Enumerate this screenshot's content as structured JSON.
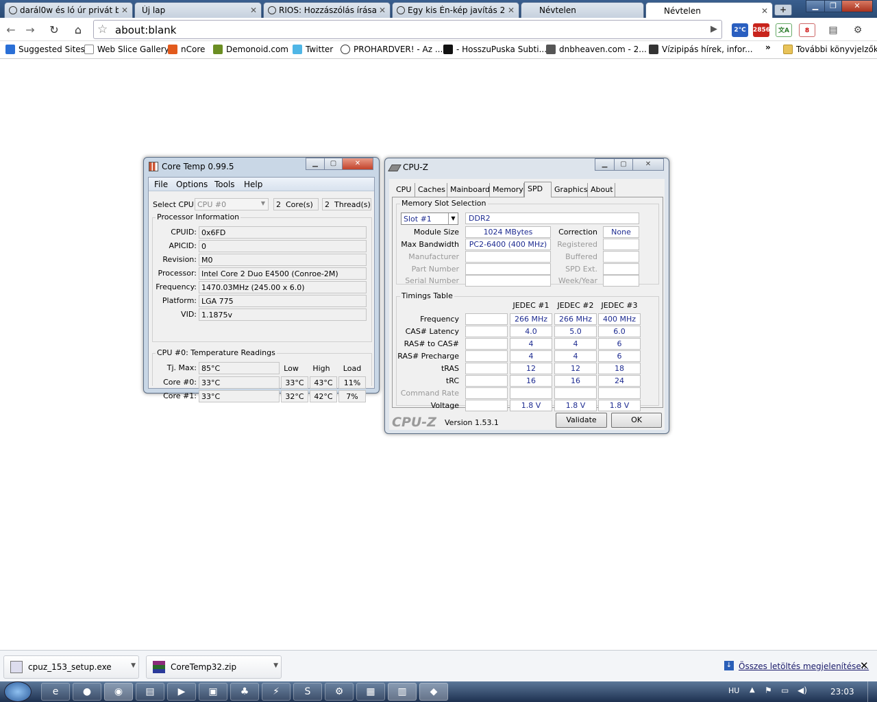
{
  "browser": {
    "tabs": [
      {
        "title": "darál0w és ló úr privát b..."
      },
      {
        "title": "Új lap"
      },
      {
        "title": "RIOS: Hozzászólás írása ..."
      },
      {
        "title": "Egy kis Én-kép javítás 2..."
      },
      {
        "title": "Névtelen"
      },
      {
        "title": "Névtelen"
      }
    ],
    "url": "about:blank",
    "extensions": {
      "temp": "2°C",
      "mail": "2856",
      "badge": "8"
    },
    "bookmarks": [
      "Suggested Sites",
      "Web Slice Gallery",
      "nCore",
      "Demonoid.com",
      "Twitter",
      "PROHARDVER! - Az ...",
      "- HosszuPuska Subti...",
      "dnbheaven.com - 2...",
      "Vízipipás hírek, infor..."
    ],
    "more_bookmarks": "További könyvjelzők",
    "chevron": "»"
  },
  "coretemp": {
    "title": "Core Temp 0.99.5",
    "menu": [
      "File",
      "Options",
      "Tools",
      "Help"
    ],
    "select_cpu_label": "Select CPU:",
    "select_cpu_value": "CPU #0",
    "cores_count": "2",
    "cores_label": "Core(s)",
    "threads_count": "2",
    "threads_label": "Thread(s)",
    "proc_info_title": "Processor Information",
    "info": [
      {
        "label": "CPUID:",
        "value": "0x6FD"
      },
      {
        "label": "APICID:",
        "value": "0"
      },
      {
        "label": "Revision:",
        "value": "M0"
      },
      {
        "label": "Processor:",
        "value": "Intel Core 2 Duo E4500 (Conroe-2M)"
      },
      {
        "label": "Frequency:",
        "value": "1470.03MHz (245.00 x 6.0)"
      },
      {
        "label": "Platform:",
        "value": "LGA 775"
      },
      {
        "label": "VID:",
        "value": "1.1875v"
      }
    ],
    "temp_title": "CPU #0: Temperature Readings",
    "col_low": "Low",
    "col_high": "High",
    "col_load": "Load",
    "tjmax_label": "Tj. Max:",
    "tjmax_value": "85°C",
    "cores": [
      {
        "label": "Core #0:",
        "temp": "33°C",
        "low": "33°C",
        "high": "43°C",
        "load": "11%"
      },
      {
        "label": "Core #1:",
        "temp": "33°C",
        "low": "32°C",
        "high": "42°C",
        "load": "7%"
      }
    ]
  },
  "cpuz": {
    "title": "CPU-Z",
    "tabs": [
      "CPU",
      "Caches",
      "Mainboard",
      "Memory",
      "SPD",
      "Graphics",
      "About"
    ],
    "slot_group_title": "Memory Slot Selection",
    "slot_value": "Slot #1",
    "mem_type": "DDR2",
    "module_size_label": "Module Size",
    "module_size": "1024 MBytes",
    "max_bw_label": "Max Bandwidth",
    "max_bw": "PC2-6400 (400 MHz)",
    "manufacturer_label": "Manufacturer",
    "part_label": "Part Number",
    "serial_label": "Serial Number",
    "correction_label": "Correction",
    "correction": "None",
    "registered_label": "Registered",
    "buffered_label": "Buffered",
    "spdext_label": "SPD Ext.",
    "weekyear_label": "Week/Year",
    "timings_title": "Timings Table",
    "jedec_headers": [
      "JEDEC #1",
      "JEDEC #2",
      "JEDEC #3"
    ],
    "timing_rows": [
      {
        "label": "Frequency",
        "vals": [
          "266 MHz",
          "266 MHz",
          "400 MHz"
        ],
        "dim": false
      },
      {
        "label": "CAS# Latency",
        "vals": [
          "4.0",
          "5.0",
          "6.0"
        ],
        "dim": false
      },
      {
        "label": "RAS# to CAS#",
        "vals": [
          "4",
          "4",
          "6"
        ],
        "dim": false
      },
      {
        "label": "RAS# Precharge",
        "vals": [
          "4",
          "4",
          "6"
        ],
        "dim": false
      },
      {
        "label": "tRAS",
        "vals": [
          "12",
          "12",
          "18"
        ],
        "dim": false
      },
      {
        "label": "tRC",
        "vals": [
          "16",
          "16",
          "24"
        ],
        "dim": false
      },
      {
        "label": "Command Rate",
        "vals": [
          "",
          "",
          ""
        ],
        "dim": true
      },
      {
        "label": "Voltage",
        "vals": [
          "1.8 V",
          "1.8 V",
          "1.8 V"
        ],
        "dim": false
      }
    ],
    "logo": "CPU-Z",
    "version": "Version 1.53.1",
    "validate": "Validate",
    "ok": "OK"
  },
  "downloads": {
    "items": [
      "cpuz_153_setup.exe",
      "CoreTemp32.zip"
    ],
    "show_all": "Összes letöltés megjelenítése..."
  },
  "taskbar": {
    "lang": "HU",
    "time": "23:03"
  }
}
